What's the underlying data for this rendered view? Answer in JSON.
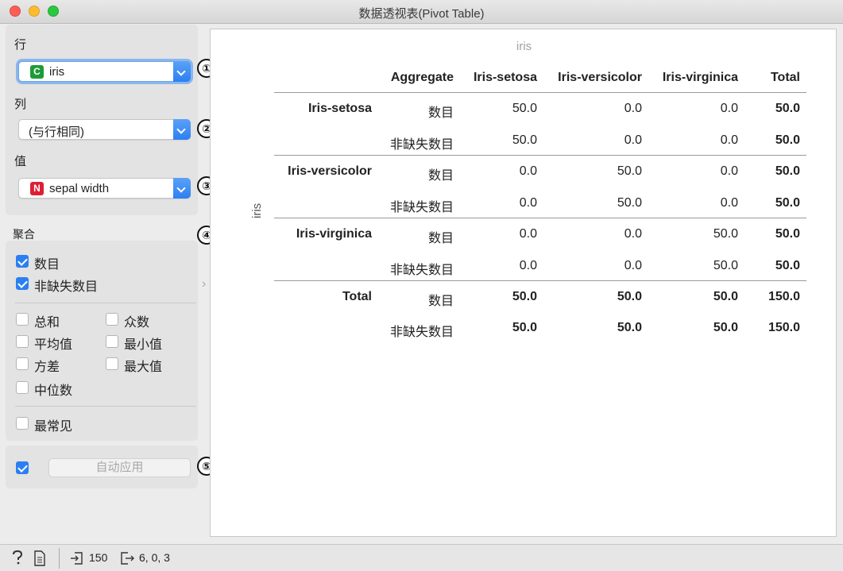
{
  "window": {
    "title": "数据透视表(Pivot Table)"
  },
  "left": {
    "row_label": "行",
    "row_value": "iris",
    "row_badge": "C",
    "col_label": "列",
    "col_value": "(与行相同)",
    "val_label": "值",
    "val_value": "sepal width",
    "val_badge": "N",
    "agg_label": "聚合",
    "aggregates": {
      "count": {
        "label": "数目",
        "checked": true
      },
      "count_defined": {
        "label": "非缺失数目",
        "checked": true
      },
      "sum": {
        "label": "总和",
        "checked": false
      },
      "mode": {
        "label": "众数",
        "checked": false
      },
      "mean": {
        "label": "平均值",
        "checked": false
      },
      "min": {
        "label": "最小值",
        "checked": false
      },
      "variance": {
        "label": "方差",
        "checked": false
      },
      "max": {
        "label": "最大值",
        "checked": false
      },
      "median": {
        "label": "中位数",
        "checked": false
      },
      "majority": {
        "label": "最常见",
        "checked": false
      }
    },
    "auto_apply_checked": true,
    "apply_label": "自动应用"
  },
  "callouts": [
    "①",
    "②",
    "③",
    "④",
    "⑤"
  ],
  "table": {
    "column_header": "iris",
    "row_header": "iris",
    "header": [
      "Aggregate",
      "Iris-setosa",
      "Iris-versicolor",
      "Iris-virginica",
      "Total"
    ],
    "groups": [
      {
        "label": "Iris-setosa",
        "rows": [
          {
            "agg": "数目",
            "values": [
              "50.0",
              "0.0",
              "0.0",
              "50.0"
            ]
          },
          {
            "agg": "非缺失数目",
            "values": [
              "50.0",
              "0.0",
              "0.0",
              "50.0"
            ]
          }
        ]
      },
      {
        "label": "Iris-versicolor",
        "rows": [
          {
            "agg": "数目",
            "values": [
              "0.0",
              "50.0",
              "0.0",
              "50.0"
            ]
          },
          {
            "agg": "非缺失数目",
            "values": [
              "0.0",
              "50.0",
              "0.0",
              "50.0"
            ]
          }
        ]
      },
      {
        "label": "Iris-virginica",
        "rows": [
          {
            "agg": "数目",
            "values": [
              "0.0",
              "0.0",
              "50.0",
              "50.0"
            ]
          },
          {
            "agg": "非缺失数目",
            "values": [
              "0.0",
              "0.0",
              "50.0",
              "50.0"
            ]
          }
        ]
      },
      {
        "label": "Total",
        "rows": [
          {
            "agg": "数目",
            "values": [
              "50.0",
              "50.0",
              "50.0",
              "150.0"
            ]
          },
          {
            "agg": "非缺失数目",
            "values": [
              "50.0",
              "50.0",
              "50.0",
              "150.0"
            ]
          }
        ]
      }
    ]
  },
  "status": {
    "input_count": "150",
    "output_summary": "6, 0, 3"
  }
}
